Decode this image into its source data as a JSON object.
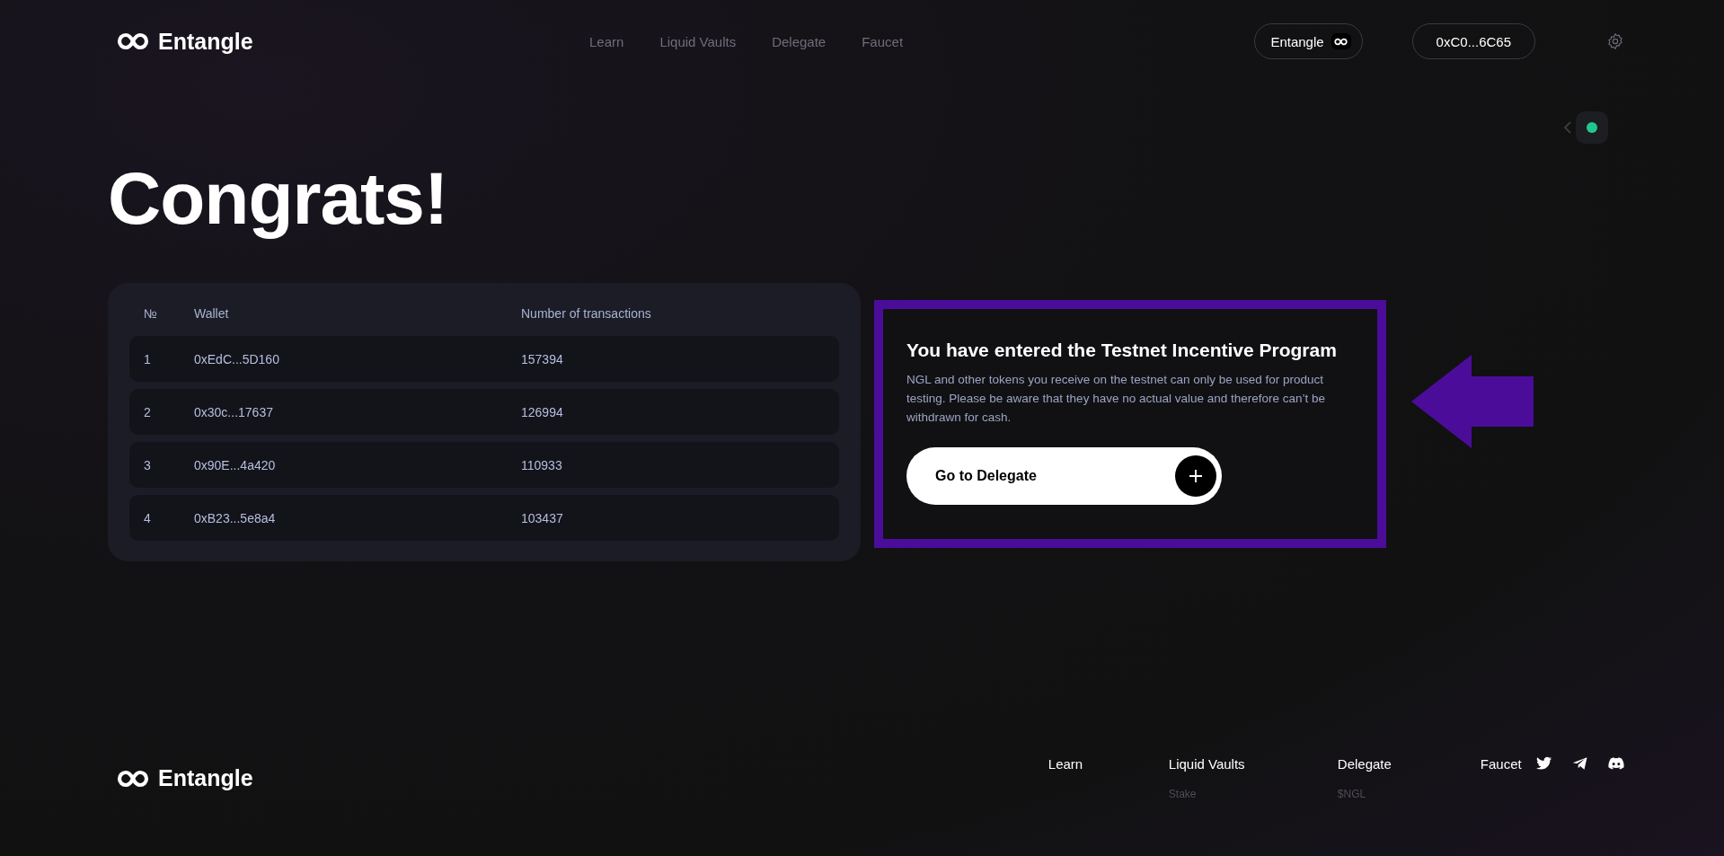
{
  "header": {
    "logo": "Entangle",
    "nav": [
      {
        "label": "Learn"
      },
      {
        "label": "Liquid Vaults"
      },
      {
        "label": "Delegate"
      },
      {
        "label": "Faucet"
      }
    ],
    "network_button": "Entangle",
    "wallet_button": "0xC0...6C65"
  },
  "title": "Congrats!",
  "leaderboard": {
    "columns": [
      "№",
      "Wallet",
      "Number of transactions"
    ],
    "rows": [
      [
        "1",
        "0xEdC...5D160",
        "157394"
      ],
      [
        "2",
        "0x30c...17637",
        "126994"
      ],
      [
        "3",
        "0x90E...4a420",
        "110933"
      ],
      [
        "4",
        "0xB23...5e8a4",
        "103437"
      ]
    ]
  },
  "notice": {
    "title": "You have entered the Testnet Incentive Program",
    "text": "NGL and other tokens you receive on the testnet can only be used for product testing. Please be aware that they have no actual value and therefore can’t be withdrawn for cash.",
    "button": "Go to Delegate"
  },
  "footer": {
    "logo": "Entangle",
    "columns": [
      {
        "label": "Learn"
      },
      {
        "label": "Liquid Vaults",
        "links": [
          "Stake"
        ]
      },
      {
        "label": "Delegate",
        "links": [
          "$NGL"
        ]
      },
      {
        "label": "Faucet"
      }
    ]
  }
}
